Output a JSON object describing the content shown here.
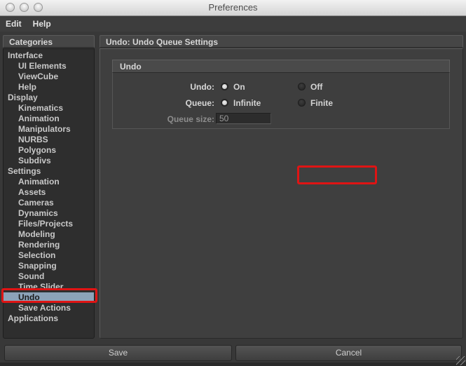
{
  "window": {
    "title": "Preferences"
  },
  "menu": {
    "items": [
      {
        "label": "Edit"
      },
      {
        "label": "Help"
      }
    ]
  },
  "sidebar": {
    "header": "Categories",
    "items": [
      {
        "label": "Interface",
        "level": 0,
        "selected": false
      },
      {
        "label": "UI Elements",
        "level": 1,
        "selected": false
      },
      {
        "label": "ViewCube",
        "level": 1,
        "selected": false
      },
      {
        "label": "Help",
        "level": 1,
        "selected": false
      },
      {
        "label": "Display",
        "level": 0,
        "selected": false
      },
      {
        "label": "Kinematics",
        "level": 1,
        "selected": false
      },
      {
        "label": "Animation",
        "level": 1,
        "selected": false
      },
      {
        "label": "Manipulators",
        "level": 1,
        "selected": false
      },
      {
        "label": "NURBS",
        "level": 1,
        "selected": false
      },
      {
        "label": "Polygons",
        "level": 1,
        "selected": false
      },
      {
        "label": "Subdivs",
        "level": 1,
        "selected": false
      },
      {
        "label": "Settings",
        "level": 0,
        "selected": false
      },
      {
        "label": "Animation",
        "level": 1,
        "selected": false
      },
      {
        "label": "Assets",
        "level": 1,
        "selected": false
      },
      {
        "label": "Cameras",
        "level": 1,
        "selected": false
      },
      {
        "label": "Dynamics",
        "level": 1,
        "selected": false
      },
      {
        "label": "Files/Projects",
        "level": 1,
        "selected": false
      },
      {
        "label": "Modeling",
        "level": 1,
        "selected": false
      },
      {
        "label": "Rendering",
        "level": 1,
        "selected": false
      },
      {
        "label": "Selection",
        "level": 1,
        "selected": false
      },
      {
        "label": "Snapping",
        "level": 1,
        "selected": false
      },
      {
        "label": "Sound",
        "level": 1,
        "selected": false
      },
      {
        "label": "Time Slider",
        "level": 1,
        "selected": false
      },
      {
        "label": "Undo",
        "level": 1,
        "selected": true,
        "annotated": true
      },
      {
        "label": "Save Actions",
        "level": 1,
        "selected": false
      },
      {
        "label": "Applications",
        "level": 0,
        "selected": false
      }
    ]
  },
  "main": {
    "header": "Undo: Undo Queue Settings",
    "group": {
      "title": "Undo",
      "rows": [
        {
          "label": "Undo:",
          "options": [
            {
              "label": "On",
              "selected": true
            },
            {
              "label": "Off",
              "selected": false
            }
          ]
        },
        {
          "label": "Queue:",
          "annotated": true,
          "options": [
            {
              "label": "Infinite",
              "selected": true
            },
            {
              "label": "Finite",
              "selected": false
            }
          ]
        },
        {
          "label": "Queue size:",
          "disabled": true,
          "value": "50"
        }
      ]
    }
  },
  "footer": {
    "save_label": "Save",
    "cancel_label": "Cancel"
  },
  "colors": {
    "annotation": "#df1414",
    "selection": "#8ca3b9",
    "window_bg": "#383838",
    "menubar_bg": "#3d3d3d",
    "header_bg": "#464646",
    "sidebar_bg": "#2e2e2e",
    "panel_bg": "#3f3f3f",
    "group_header_bg": "#4a4a4a",
    "group_bg": "#3e3e3e"
  }
}
